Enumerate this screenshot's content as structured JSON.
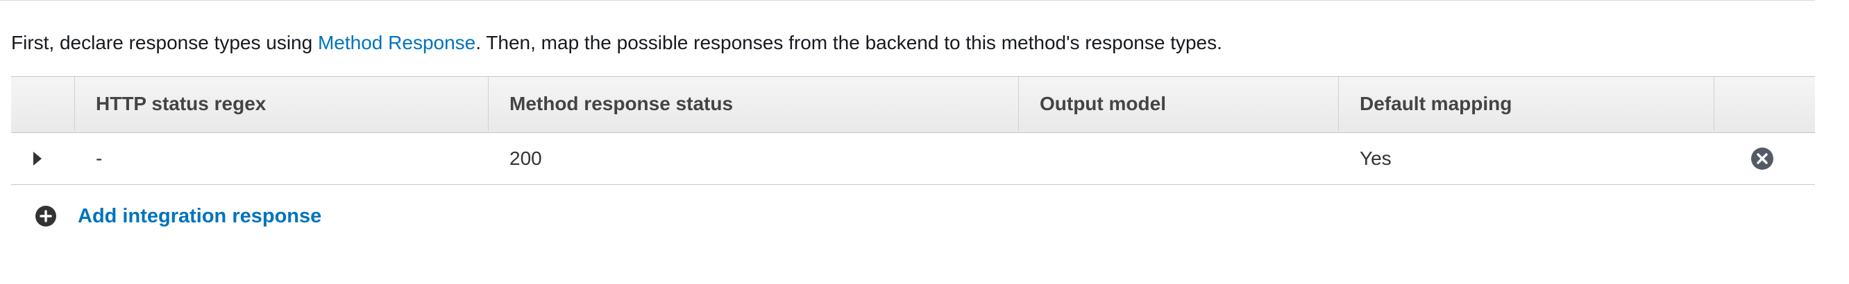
{
  "intro": {
    "prefix": "First, declare response types using ",
    "link": "Method Response",
    "suffix": ". Then, map the possible responses from the backend to this method's response types."
  },
  "table": {
    "columns": [
      "",
      "HTTP status regex",
      "Method response status",
      "Output model",
      "Default mapping",
      ""
    ],
    "rows": [
      {
        "http_status_regex": "-",
        "method_response_status": "200",
        "output_model": "",
        "default_mapping": "Yes"
      }
    ]
  },
  "actions": {
    "add_integration_response": "Add integration response"
  },
  "icons": {
    "expand": "caret-right-icon",
    "remove": "remove-circle-icon",
    "add": "add-circle-icon"
  },
  "colors": {
    "link": "#0073bb",
    "header_bg": "#eeeeee",
    "icon": "#545b64"
  }
}
